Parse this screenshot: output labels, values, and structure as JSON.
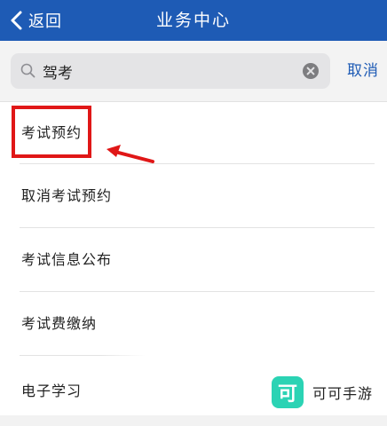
{
  "navbar": {
    "back_label": "返回",
    "title": "业务中心",
    "background_color": "#1e5bb5"
  },
  "search": {
    "value": "驾考",
    "placeholder": "",
    "cancel_label": "取消",
    "search_icon": "search-icon",
    "clear_icon": "clear-icon"
  },
  "list": {
    "items": [
      {
        "label": "考试预约",
        "highlighted": true
      },
      {
        "label": "取消考试预约"
      },
      {
        "label": "考试信息公布"
      },
      {
        "label": "考试费缴纳"
      },
      {
        "label": "电子学习"
      }
    ]
  },
  "annotation": {
    "highlight_color": "#e01717"
  },
  "watermark": {
    "logo_glyph": "可",
    "text": "可可手游",
    "logo_color": "#2bd3b4"
  }
}
